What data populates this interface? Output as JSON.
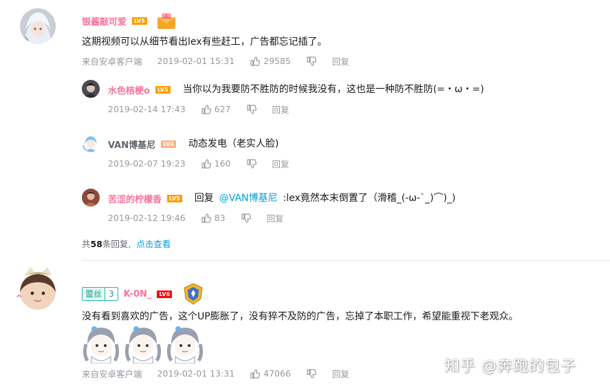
{
  "comments": [
    {
      "username": "银酱敲可爱",
      "level": "LV5",
      "text": "这期视频可以从细节看出lex有些赶工，广告都忘记插了。",
      "client": "来自安卓客户端",
      "time": "2019-02-01 15:31",
      "likes": "29585",
      "reply_label": "回复",
      "replies": [
        {
          "username": "水色桔梗o",
          "level": "LV5",
          "text": "当你以为我要防不胜防的时候我没有，这也是一种防不胜防(=・ω・=)",
          "time": "2019-02-14 17:43",
          "likes": "627",
          "reply_label": "回复"
        },
        {
          "username": "VAN博基尼",
          "level": "LV4",
          "text": "动态发电（老实人脸)",
          "time": "2019-02-07 19:23",
          "likes": "160",
          "reply_label": "回复"
        },
        {
          "username": "苦涩的柠檬香",
          "level": "LV5",
          "text_prefix": "回复",
          "mention": "@VAN博基尼",
          "text": ":lex竟然本末倒置了（滑稽_(-ω-`_)⌒)_)",
          "time": "2019-02-12 19:46",
          "likes": "83",
          "reply_label": "回复"
        }
      ],
      "more": {
        "prefix": "共",
        "count": "58",
        "suffix": "条回复,",
        "link": "点击查看"
      }
    },
    {
      "fan_badge_name": "蕾丝",
      "fan_badge_level": "3",
      "username": "K-0N_",
      "level": "LV6",
      "text": "没有看到喜欢的广告，这个UP膨胀了，没有猝不及防的广告，忘掉了本职工作，希望能重视下老观众。",
      "client": "来自安卓客户端",
      "time": "2019-02-01 13:31",
      "likes": "47066",
      "reply_label": "回复"
    }
  ],
  "watermark": "知乎 @奔跑的包子",
  "colors": {
    "pink_name": "#fb7299",
    "link_blue": "#00a1d6",
    "meta_gray": "#9499a0",
    "fan_green": "#23b7a3"
  },
  "icons": [
    "like-icon",
    "dislike-icon",
    "avatar-icon",
    "badge-icon",
    "emoji-sticker-icon"
  ]
}
